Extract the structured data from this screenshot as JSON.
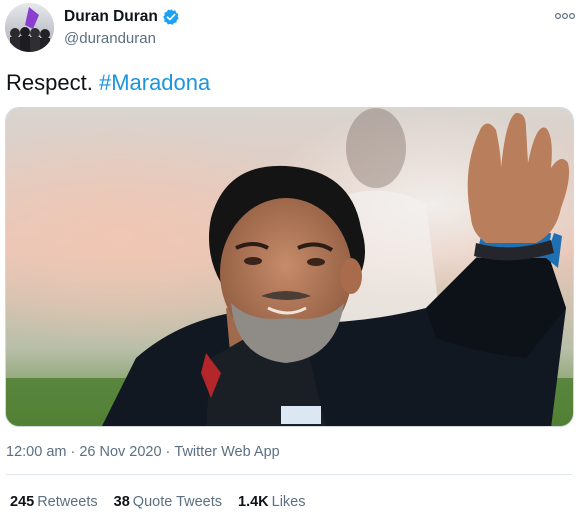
{
  "user": {
    "display_name": "Duran Duran",
    "handle": "@duranduran",
    "verified": true
  },
  "tweet": {
    "text": "Respect.",
    "hashtag": "#Maradona"
  },
  "meta": {
    "time": "12:00 am",
    "separator": "·",
    "date": "26 Nov 2020",
    "source": "Twitter Web App"
  },
  "stats": {
    "retweets_count": "245",
    "retweets_label": "Retweets",
    "quotes_count": "38",
    "quotes_label": "Quote Tweets",
    "likes_count": "1.4K",
    "likes_label": "Likes"
  },
  "colors": {
    "accent": "#1b95e0",
    "text": "#0f1419",
    "secondary": "#5b7083",
    "verified": "#1da1f2"
  },
  "icons": {
    "verified": "verified-badge-icon",
    "more": "more-options-icon"
  }
}
